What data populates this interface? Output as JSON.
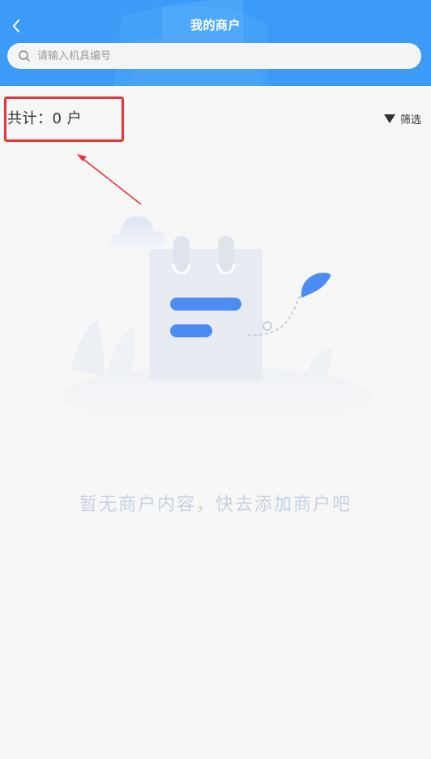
{
  "header": {
    "title": "我的商户"
  },
  "search": {
    "placeholder": "请输入机具编号"
  },
  "summary": {
    "total_text": "共计：0 户"
  },
  "filter": {
    "label": "筛选"
  },
  "empty_state": {
    "message": "暂无商户内容，快去添加商户吧"
  },
  "colors": {
    "header_bg": "#3b9bf7",
    "highlight_border": "#e8333a",
    "empty_text": "#c5d2e3"
  }
}
